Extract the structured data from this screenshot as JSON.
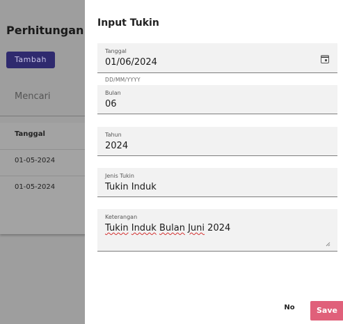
{
  "background": {
    "page_title": "Perhitungan T",
    "add_button": "Tambah",
    "search_placeholder": "Mencari",
    "table_header": "Tanggal",
    "rows": [
      "01-05-2024",
      "01-05-2024"
    ]
  },
  "dialog": {
    "title": "Input Tukin",
    "tanggal": {
      "label": "Tanggal",
      "value": "01/06/2024",
      "hint": "DD/MM/YYYY",
      "icon": "calendar-icon"
    },
    "bulan": {
      "label": "Bulan",
      "value": "06"
    },
    "tahun": {
      "label": "Tahun",
      "value": "2024"
    },
    "jenis": {
      "label": "Jenis Tukin",
      "value": "Tukin Induk"
    },
    "keterangan": {
      "label": "Keterangan",
      "words": [
        "Tukin",
        "Induk",
        "Bulan",
        "Juni",
        "2024"
      ]
    },
    "no_label": "No",
    "save_label": "Save"
  }
}
